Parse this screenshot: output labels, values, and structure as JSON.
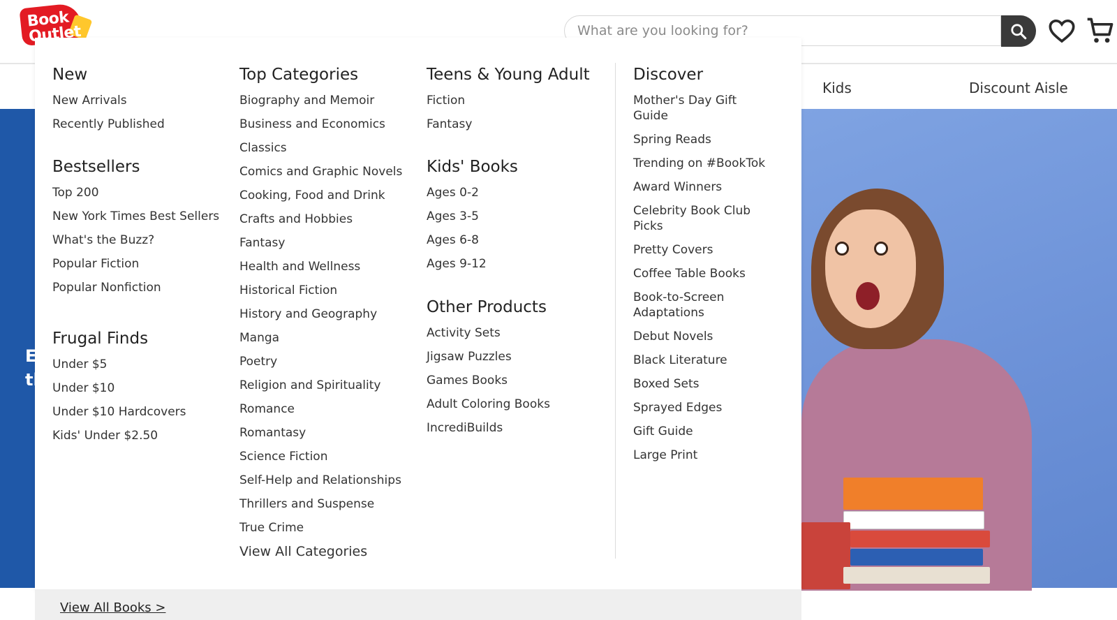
{
  "header": {
    "logo_text": "Book Outlet",
    "search_placeholder": "What are you looking for?",
    "search_button_icon": "search-icon",
    "wishlist_icon": "heart-icon",
    "cart_icon": "cart-icon"
  },
  "nav": {
    "items": [
      "Kids",
      "Discount Aisle"
    ]
  },
  "hero": {
    "text_line1": "E",
    "text_line2": "tl"
  },
  "menu": {
    "new": {
      "heading": "New",
      "links": [
        "New Arrivals",
        "Recently Published"
      ]
    },
    "bestsellers": {
      "heading": "Bestsellers",
      "links": [
        "Top 200",
        "New York Times Best Sellers",
        "What's the Buzz?",
        "Popular Fiction",
        "Popular Nonfiction"
      ]
    },
    "frugal": {
      "heading": "Frugal Finds",
      "links": [
        "Under $5",
        "Under $10",
        "Under $10 Hardcovers",
        "Kids' Under $2.50"
      ]
    },
    "top_categories": {
      "heading": "Top Categories",
      "links": [
        "Biography and Memoir",
        "Business and Economics",
        "Classics",
        "Comics and Graphic Novels",
        "Cooking, Food and Drink",
        "Crafts and Hobbies",
        "Fantasy",
        "Health and Wellness",
        "Historical Fiction",
        "History and Geography",
        "Manga",
        "Poetry",
        "Religion and Spirituality",
        "Romance",
        "Romantasy",
        "Science Fiction",
        "Self-Help and Relationships",
        "Thrillers and Suspense",
        "True Crime"
      ],
      "view_all": "View All Categories"
    },
    "teens": {
      "heading": "Teens & Young Adult",
      "links": [
        "Fiction",
        "Fantasy"
      ]
    },
    "kids": {
      "heading": "Kids' Books",
      "links": [
        "Ages 0-2",
        "Ages 3-5",
        "Ages 6-8",
        "Ages 9-12"
      ]
    },
    "other": {
      "heading": "Other Products",
      "links": [
        "Activity Sets",
        "Jigsaw Puzzles",
        "Games Books",
        "Adult Coloring Books",
        "IncrediBuilds"
      ]
    },
    "discover": {
      "heading": "Discover",
      "links": [
        "Mother's Day Gift Guide",
        "Spring Reads",
        "Trending on #BookTok",
        "Award Winners",
        "Celebrity Book Club Picks",
        "Pretty Covers",
        "Coffee Table Books",
        "Book-to-Screen Adaptations",
        "Debut Novels",
        "Black Literature",
        "Boxed Sets",
        "Sprayed Edges",
        "Gift Guide",
        "Large Print"
      ]
    },
    "footer_link": "View All Books >"
  },
  "colors": {
    "brand_red": "#e31b23",
    "brand_yellow": "#ffc72c",
    "hero_blue": "#1f58a8",
    "search_button": "#3a3a3a"
  }
}
